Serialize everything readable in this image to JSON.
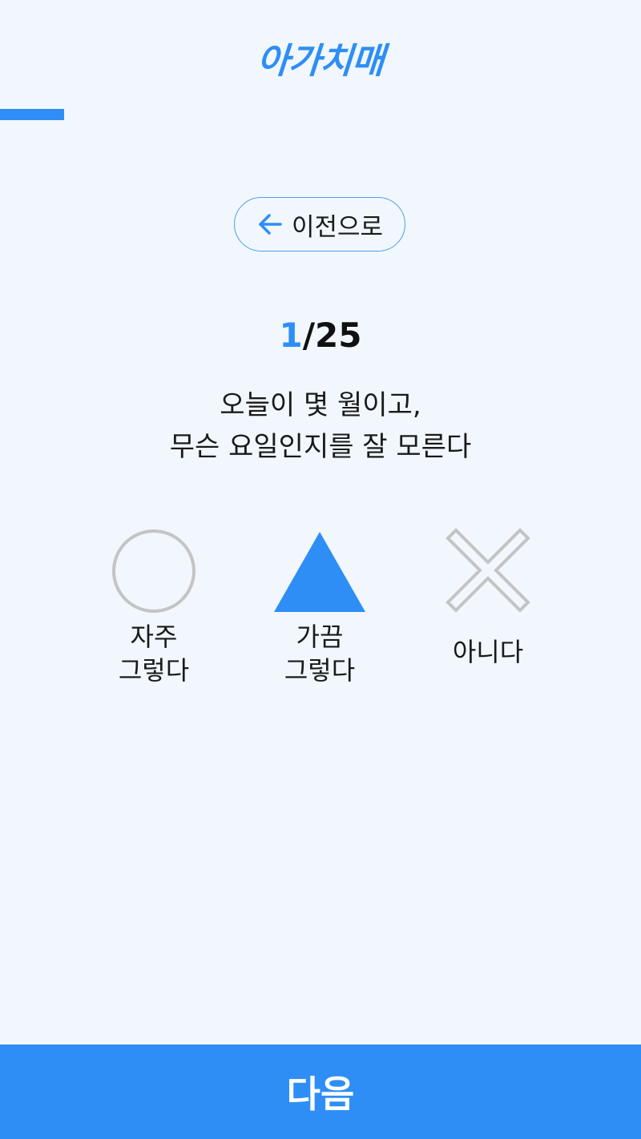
{
  "app": {
    "logo_text": "아가치매"
  },
  "progress": {
    "current": 1,
    "total": 25,
    "fraction": 0.04
  },
  "nav": {
    "back_label": "이전으로"
  },
  "counter": {
    "current": "1",
    "separator_total": "/25"
  },
  "question": {
    "line1": "오늘이 몇 월이고,",
    "line2": "무슨 요일인지를 잘 모른다"
  },
  "options": [
    {
      "icon": "circle-icon",
      "line1": "자주",
      "line2": "그렇다",
      "color": "#c4c4c4",
      "selected": false
    },
    {
      "icon": "triangle-icon",
      "line1": "가끔",
      "line2": "그렇다",
      "color": "#2e8ef5",
      "selected": true
    },
    {
      "icon": "x-icon",
      "line1": "아니다",
      "color": "#c4c4c4",
      "selected": false
    }
  ],
  "footer": {
    "next_label": "다음"
  },
  "colors": {
    "accent": "#2e8ef5",
    "background": "#f1f7fc",
    "inactive": "#c4c4c4"
  }
}
